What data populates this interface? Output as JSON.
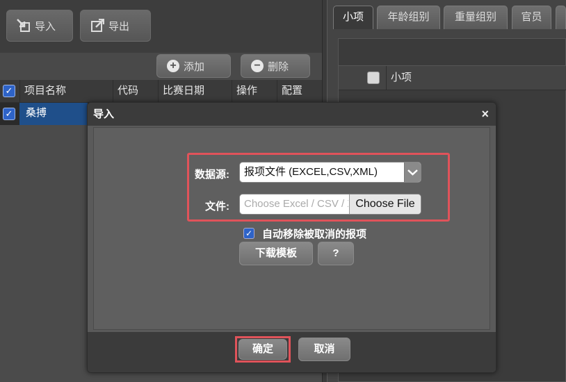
{
  "toolbar": {
    "import_label": "导入",
    "export_label": "导出"
  },
  "subtoolbar": {
    "add_label": "添加",
    "delete_label": "删除"
  },
  "grid": {
    "columns": [
      "项目名称",
      "代码",
      "比赛日期",
      "操作",
      "配置"
    ],
    "rows": [
      {
        "name": "桑搏"
      }
    ]
  },
  "tabs": [
    "小项",
    "年龄组别",
    "重量组别",
    "官员"
  ],
  "tab_grid": {
    "column": "小项"
  },
  "dialog": {
    "title": "导入",
    "close_glyph": "×",
    "source_label": "数据源:",
    "source_value": "报项文件 (EXCEL,CSV,XML)",
    "file_label": "文件:",
    "file_placeholder": "Choose Excel / CSV / XML",
    "choose_file_label": "Choose File",
    "auto_remove_label": "自动移除被取消的报项",
    "auto_remove_checked": true,
    "download_template_label": "下载模板",
    "help_label": "?",
    "ok_label": "确定",
    "cancel_label": "取消"
  },
  "colors": {
    "highlight": "#e0535a",
    "checkbox": "#2e63c8",
    "selection": "#1f4f8a"
  }
}
